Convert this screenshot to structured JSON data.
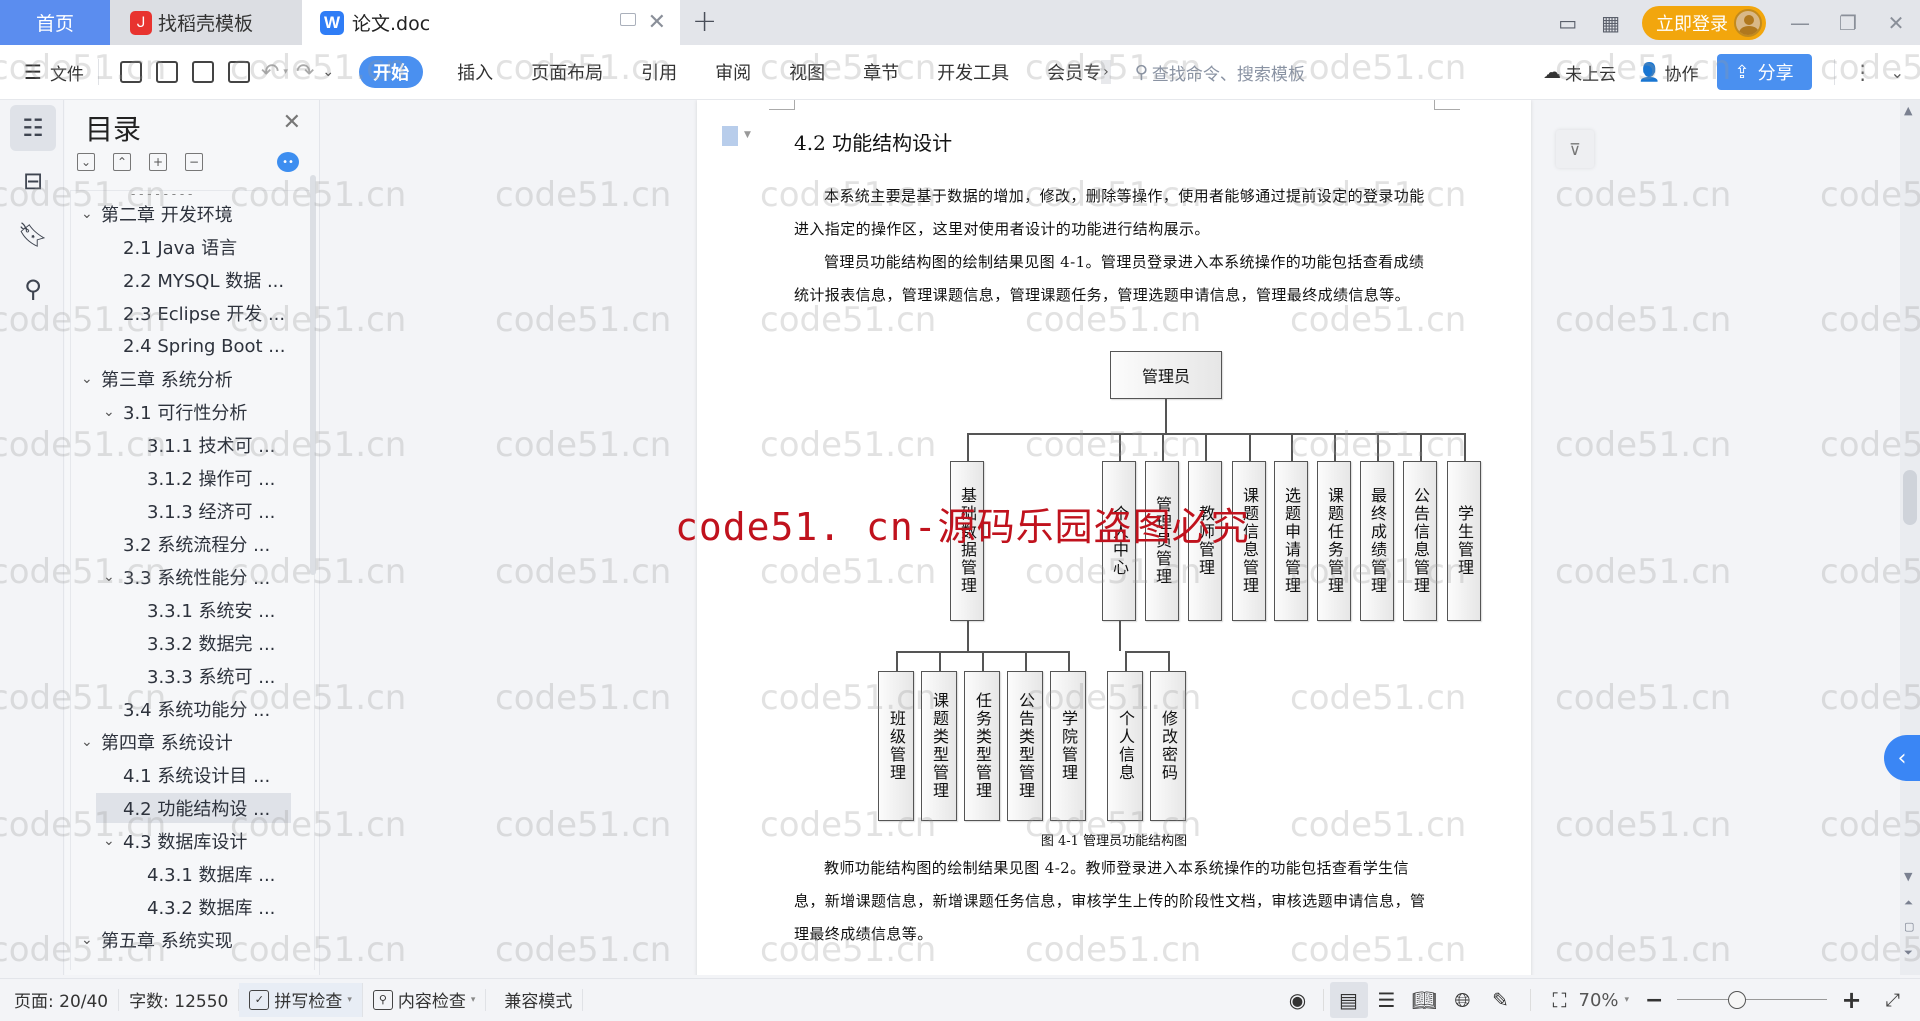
{
  "tabs": {
    "home": "首页",
    "template": "找稻壳模板",
    "doc": "论文.doc",
    "new_tab": "+"
  },
  "titlebar": {
    "login": "立即登录",
    "icons": [
      "reading-mode-icon",
      "apps-grid-icon",
      "avatar",
      "minimize-icon",
      "restore-icon",
      "close-icon"
    ]
  },
  "toolbar": {
    "file": "文件",
    "menus": [
      "开始",
      "插入",
      "页面布局",
      "引用",
      "审阅",
      "视图",
      "章节",
      "开发工具",
      "会员专"
    ],
    "more_arrow": "›",
    "search_placeholder": "查找命令、搜索模板",
    "cloud": "未上云",
    "collab": "协作",
    "share": "分享"
  },
  "sidebar": {
    "title": "目录",
    "items": [
      {
        "label": "第二章  开发环境",
        "level": 1,
        "expanded": true
      },
      {
        "label": "2.1 Java 语言",
        "level": 2
      },
      {
        "label": "2.2 MYSQL 数据 ...",
        "level": 2
      },
      {
        "label": "2.3 Eclipse 开发 ...",
        "level": 2
      },
      {
        "label": "2.4 Spring Boot  ...",
        "level": 2
      },
      {
        "label": "第三章  系统分析",
        "level": 1,
        "expanded": true
      },
      {
        "label": "3.1 可行性分析",
        "level": 2,
        "expanded": true
      },
      {
        "label": "3.1.1 技术可 ...",
        "level": 3
      },
      {
        "label": "3.1.2 操作可 ...",
        "level": 3
      },
      {
        "label": "3.1.3 经济可 ...",
        "level": 3
      },
      {
        "label": "3.2 系统流程分 ...",
        "level": 2
      },
      {
        "label": "3.3 系统性能分 ...",
        "level": 2,
        "expanded": true
      },
      {
        "label": "3.3.1 系统安 ...",
        "level": 3
      },
      {
        "label": "3.3.2 数据完 ...",
        "level": 3
      },
      {
        "label": "3.3.3 系统可 ...",
        "level": 3
      },
      {
        "label": "3.4 系统功能分 ...",
        "level": 2
      },
      {
        "label": "第四章  系统设计",
        "level": 1,
        "expanded": true
      },
      {
        "label": "4.1  系统设计目 ...",
        "level": 2
      },
      {
        "label": "4.2 功能结构设 ...",
        "level": 2,
        "selected": true
      },
      {
        "label": "4.3 数据库设计",
        "level": 2,
        "expanded": true
      },
      {
        "label": "4.3.1  数据库 ...",
        "level": 3
      },
      {
        "label": "4.3.2  数据库 ...",
        "level": 3
      },
      {
        "label": "第五章  系统实现",
        "level": 1,
        "expanded": true
      }
    ]
  },
  "document": {
    "heading": "4.2 功能结构设计",
    "para1": "本系统主要是基于数据的增加，修改，删除等操作，使用者能够通过提前设定的登录功能进入指定的操作区，这里对使用者设计的功能进行结构展示。",
    "para2": "管理员功能结构图的绘制结果见图 4-1。管理员登录进入本系统操作的功能包括查看成绩统计报表信息，管理课题信息，管理课题任务，管理选题申请信息，管理最终成绩信息等。",
    "caption": "图 4-1  管理员功能结构图",
    "para3": "教师功能结构图的绘制结果见图 4-2。教师登录进入本系统操作的功能包括查看学生信息，新增课题信息，新增课题任务信息，审核学生上传的阶段性文档，审核选题申请信息，管理最终成绩信息等。",
    "diagram": {
      "root": "管理员",
      "children": [
        "基础数据管理",
        "个人中心",
        "管理员管理",
        "教师管理",
        "课题信息管理",
        "选题申请管理",
        "课题任务管理",
        "最终成绩管理",
        "公告信息管理",
        "学生管理"
      ],
      "sub_basic": [
        "班级管理",
        "课题类型管理",
        "任务类型管理",
        "公告类型管理",
        "学院管理"
      ],
      "sub_personal": [
        "个人信息",
        "修改密码"
      ]
    }
  },
  "statusbar": {
    "page": "页面: 20/40",
    "words": "字数: 12550",
    "spell": "拼写检查",
    "content_check": "内容检查",
    "compat": "兼容模式",
    "zoom": "70%",
    "zoom_fraction": 0.4
  },
  "watermark": {
    "text": "code51.cn",
    "red": "code51. cn-源码乐园盗图必究"
  }
}
